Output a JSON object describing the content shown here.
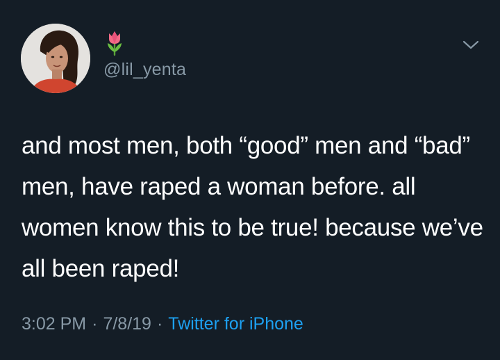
{
  "tweet": {
    "handle": "@lil_yenta",
    "display_name_emoji": "tulip-emoji",
    "text": "and most men, both “good” men and “bad” men, have raped a woman before. all women know this to be true! because we’ve all been raped!",
    "time": "3:02 PM",
    "date": "7/8/19",
    "separator": "·",
    "source": "Twitter for iPhone"
  },
  "icons": {
    "menu": "chevron-down-icon",
    "display_name": "tulip-icon"
  },
  "colors": {
    "background": "#141d26",
    "text": "#ffffff",
    "secondary": "#8899a6",
    "link": "#1da1f2"
  }
}
